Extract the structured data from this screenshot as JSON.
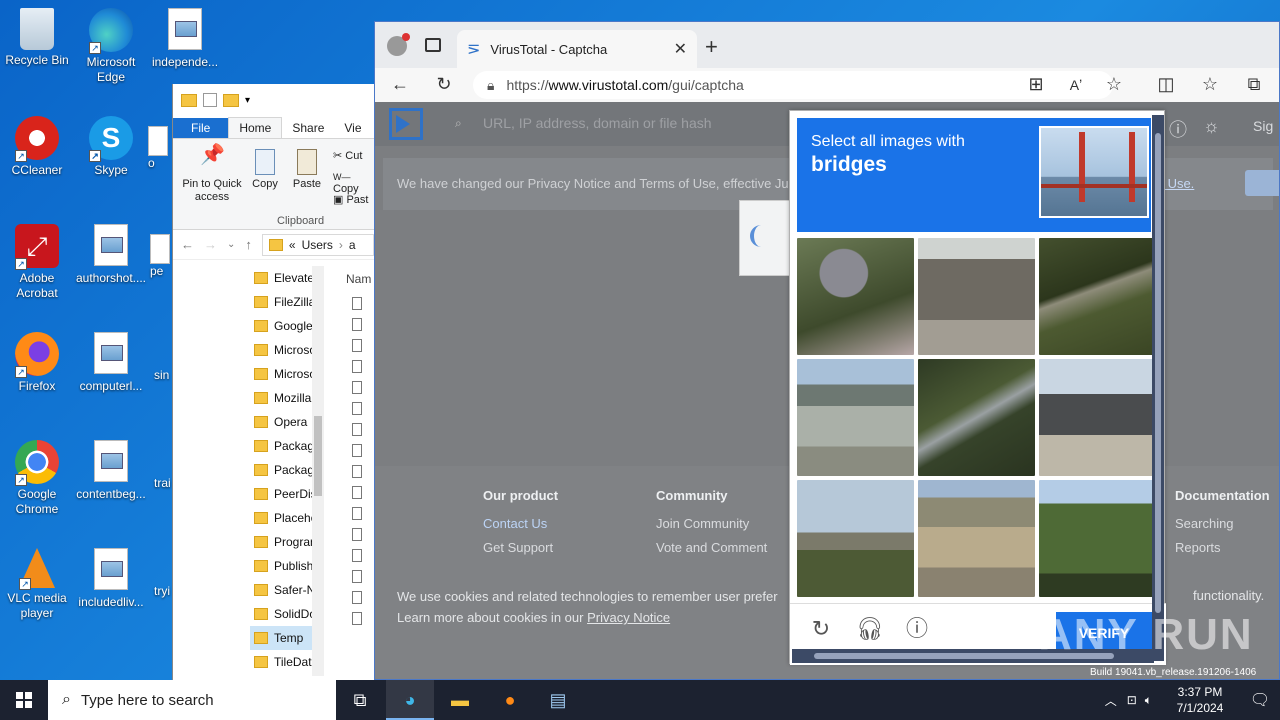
{
  "desktop": {
    "icons": [
      {
        "label": "Recycle Bin"
      },
      {
        "label": "Microsoft Edge"
      },
      {
        "label": "independe..."
      },
      {
        "label": "CCleaner"
      },
      {
        "label": "Skype"
      },
      {
        "label": "Adobe Acrobat"
      },
      {
        "label": "authorshot...."
      },
      {
        "label": "Firefox"
      },
      {
        "label": "computerl..."
      },
      {
        "label": "Google Chrome"
      },
      {
        "label": "contentbeg..."
      },
      {
        "label": "VLC media player"
      },
      {
        "label": "includedliv..."
      }
    ],
    "partial": [
      "o",
      "pe",
      "sin",
      "trai",
      "tryi"
    ]
  },
  "explorer": {
    "ribbon_tabs": [
      "File",
      "Home",
      "Share",
      "Vie"
    ],
    "ribbon": {
      "pin": "Pin to Quick access",
      "copy": "Copy",
      "paste": "Paste",
      "cut": "Cut",
      "copy_path": "Copy",
      "paste_shortcut": "Past",
      "group": "Clipboard"
    },
    "address": {
      "chev": "«",
      "path": "Users",
      "next": "a"
    },
    "nav_items": [
      "Elevate",
      "FileZilla",
      "Google",
      "Microso",
      "Microso",
      "Mozilla",
      "Opera",
      "Packag",
      "Packag",
      "PeerDis",
      "Placeho",
      "Progran",
      "Publish",
      "Safer-N",
      "SolidDo",
      "Temp",
      "TileData"
    ],
    "selected_index": 15,
    "file_header": "Nam"
  },
  "browser": {
    "tab_title": "VirusTotal - Captcha",
    "url_prefix": "https://",
    "url_domain": "www.virustotal.com",
    "url_path": "/gui/captcha",
    "page": {
      "search_placeholder": "URL, IP address, domain or file hash",
      "notice": "We have changed our Privacy Notice and Terms of Use, effective Ju",
      "notice_link": "s of Use.",
      "sign": "Sig",
      "footer": {
        "product_title": "Our product",
        "product_links": [
          "Contact Us",
          "Get Support"
        ],
        "community_title": "Community",
        "community_links": [
          "Join Community",
          "Vote and Comment"
        ],
        "docs_title": "Documentation",
        "docs_links": [
          "Searching",
          "Reports"
        ]
      },
      "cookie_line1": "We use cookies and related technologies to remember user prefer",
      "cookie_line2_a": "Learn more about cookies in our",
      "cookie_link": "Privacy Notice",
      "cookie_tail": "functionality."
    }
  },
  "captcha": {
    "instruction": "Select all images with",
    "target": "bridges",
    "verify": "VERIFY"
  },
  "watermark": "ANY RUN",
  "build_text": "Build 19041.vb_release.191206-1406",
  "taskbar": {
    "search_placeholder": "Type here to search",
    "time": "3:37 PM",
    "date": "7/1/2024"
  }
}
